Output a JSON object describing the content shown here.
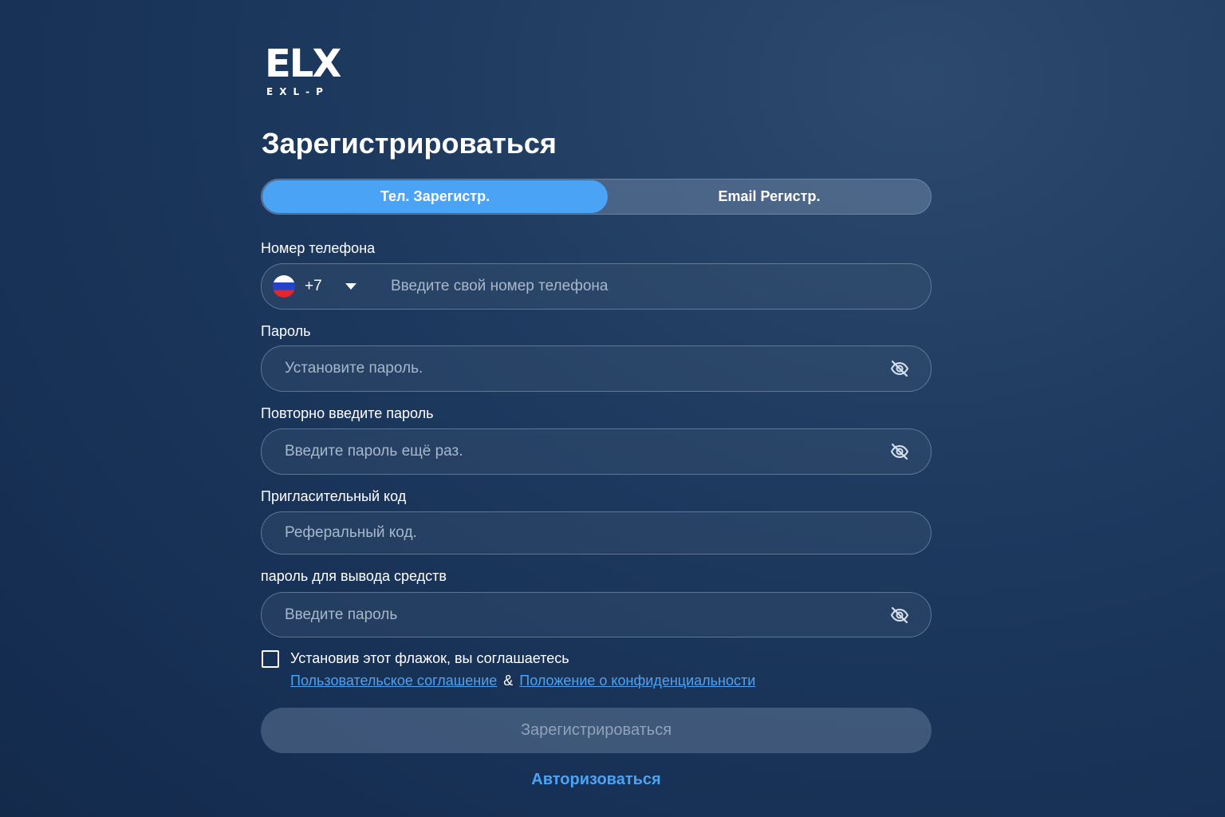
{
  "logo": {
    "mark": "ELX",
    "sub": "EXL-P"
  },
  "title": "Зарегистрироваться",
  "tabs": [
    {
      "label": "Тел. Зарегистр.",
      "active": true
    },
    {
      "label": "Email Регистр.",
      "active": false
    }
  ],
  "phone": {
    "label": "Номер телефона",
    "country_code": "+7",
    "country_flag": "russia-flag-icon",
    "placeholder": "Введите свой номер телефона",
    "value": ""
  },
  "password": {
    "label": "Пароль",
    "placeholder": "Установите пароль.",
    "value": ""
  },
  "password_repeat": {
    "label": "Повторно введите пароль",
    "placeholder": "Введите пароль ещё раз.",
    "value": ""
  },
  "invite": {
    "label": "Пригласительный код",
    "placeholder": "Реферальный код.",
    "value": ""
  },
  "withdraw_password": {
    "label": "пароль для вывода средств",
    "placeholder": "Введите пароль",
    "value": ""
  },
  "agreement": {
    "checked": false,
    "text": "Установив этот флажок, вы соглашаетесь",
    "user_agreement": "Пользовательское соглашение",
    "ampersand": "&",
    "privacy": "Положение о конфиденциальности"
  },
  "submit_label": "Зарегистрироваться",
  "login_label": "Авторизоваться",
  "colors": {
    "accent": "#4ba3f5",
    "background": "#1e3a5f",
    "text": "#ffffff"
  }
}
